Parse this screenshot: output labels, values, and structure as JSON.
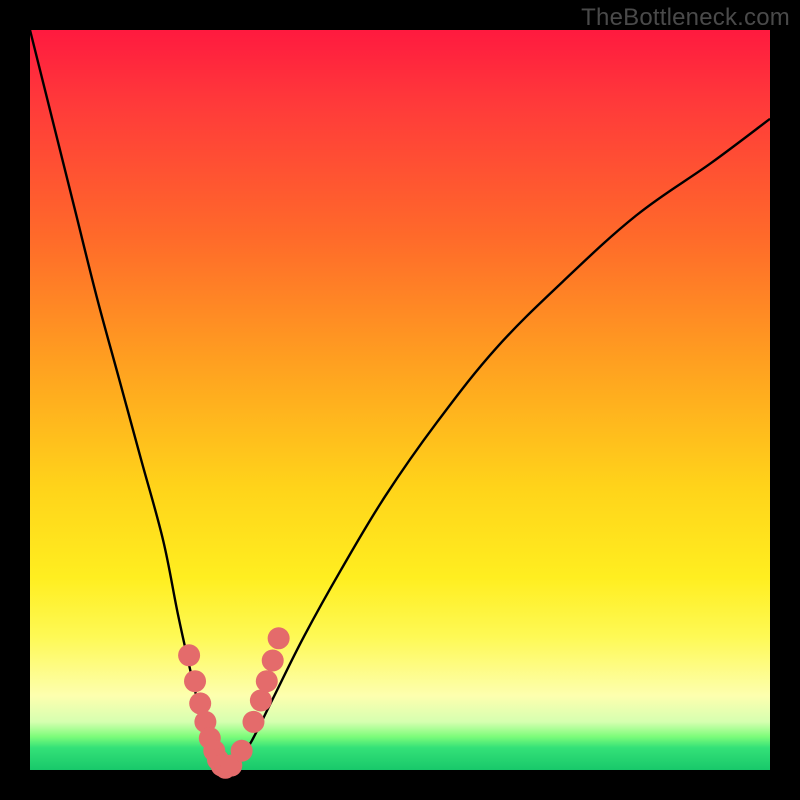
{
  "watermark": "TheBottleneck.com",
  "chart_data": {
    "type": "line",
    "title": "",
    "xlabel": "",
    "ylabel": "",
    "xlim": [
      0,
      100
    ],
    "ylim": [
      0,
      100
    ],
    "x": [
      0,
      3,
      6,
      9,
      12,
      15,
      18,
      20,
      22,
      23.5,
      25,
      26,
      27,
      28,
      30,
      33,
      37,
      42,
      48,
      55,
      63,
      72,
      82,
      92,
      100
    ],
    "y": [
      100,
      88,
      76,
      64,
      53,
      42,
      31,
      21,
      12,
      6,
      1.5,
      0,
      0,
      1,
      4,
      10,
      18,
      27,
      37,
      47,
      57,
      66,
      75,
      82,
      88
    ],
    "markers": {
      "x": [
        21.5,
        22.3,
        23.0,
        23.7,
        24.3,
        24.9,
        25.4,
        25.9,
        26.4,
        27.2,
        28.6,
        30.2,
        31.2,
        32.0,
        32.8,
        33.6
      ],
      "y": [
        15.5,
        12.0,
        9.0,
        6.5,
        4.3,
        2.6,
        1.4,
        0.6,
        0.3,
        0.6,
        2.6,
        6.5,
        9.4,
        12.0,
        14.8,
        17.8
      ]
    },
    "colors": {
      "curve": "#000000",
      "marker": "#e46b6b"
    }
  }
}
